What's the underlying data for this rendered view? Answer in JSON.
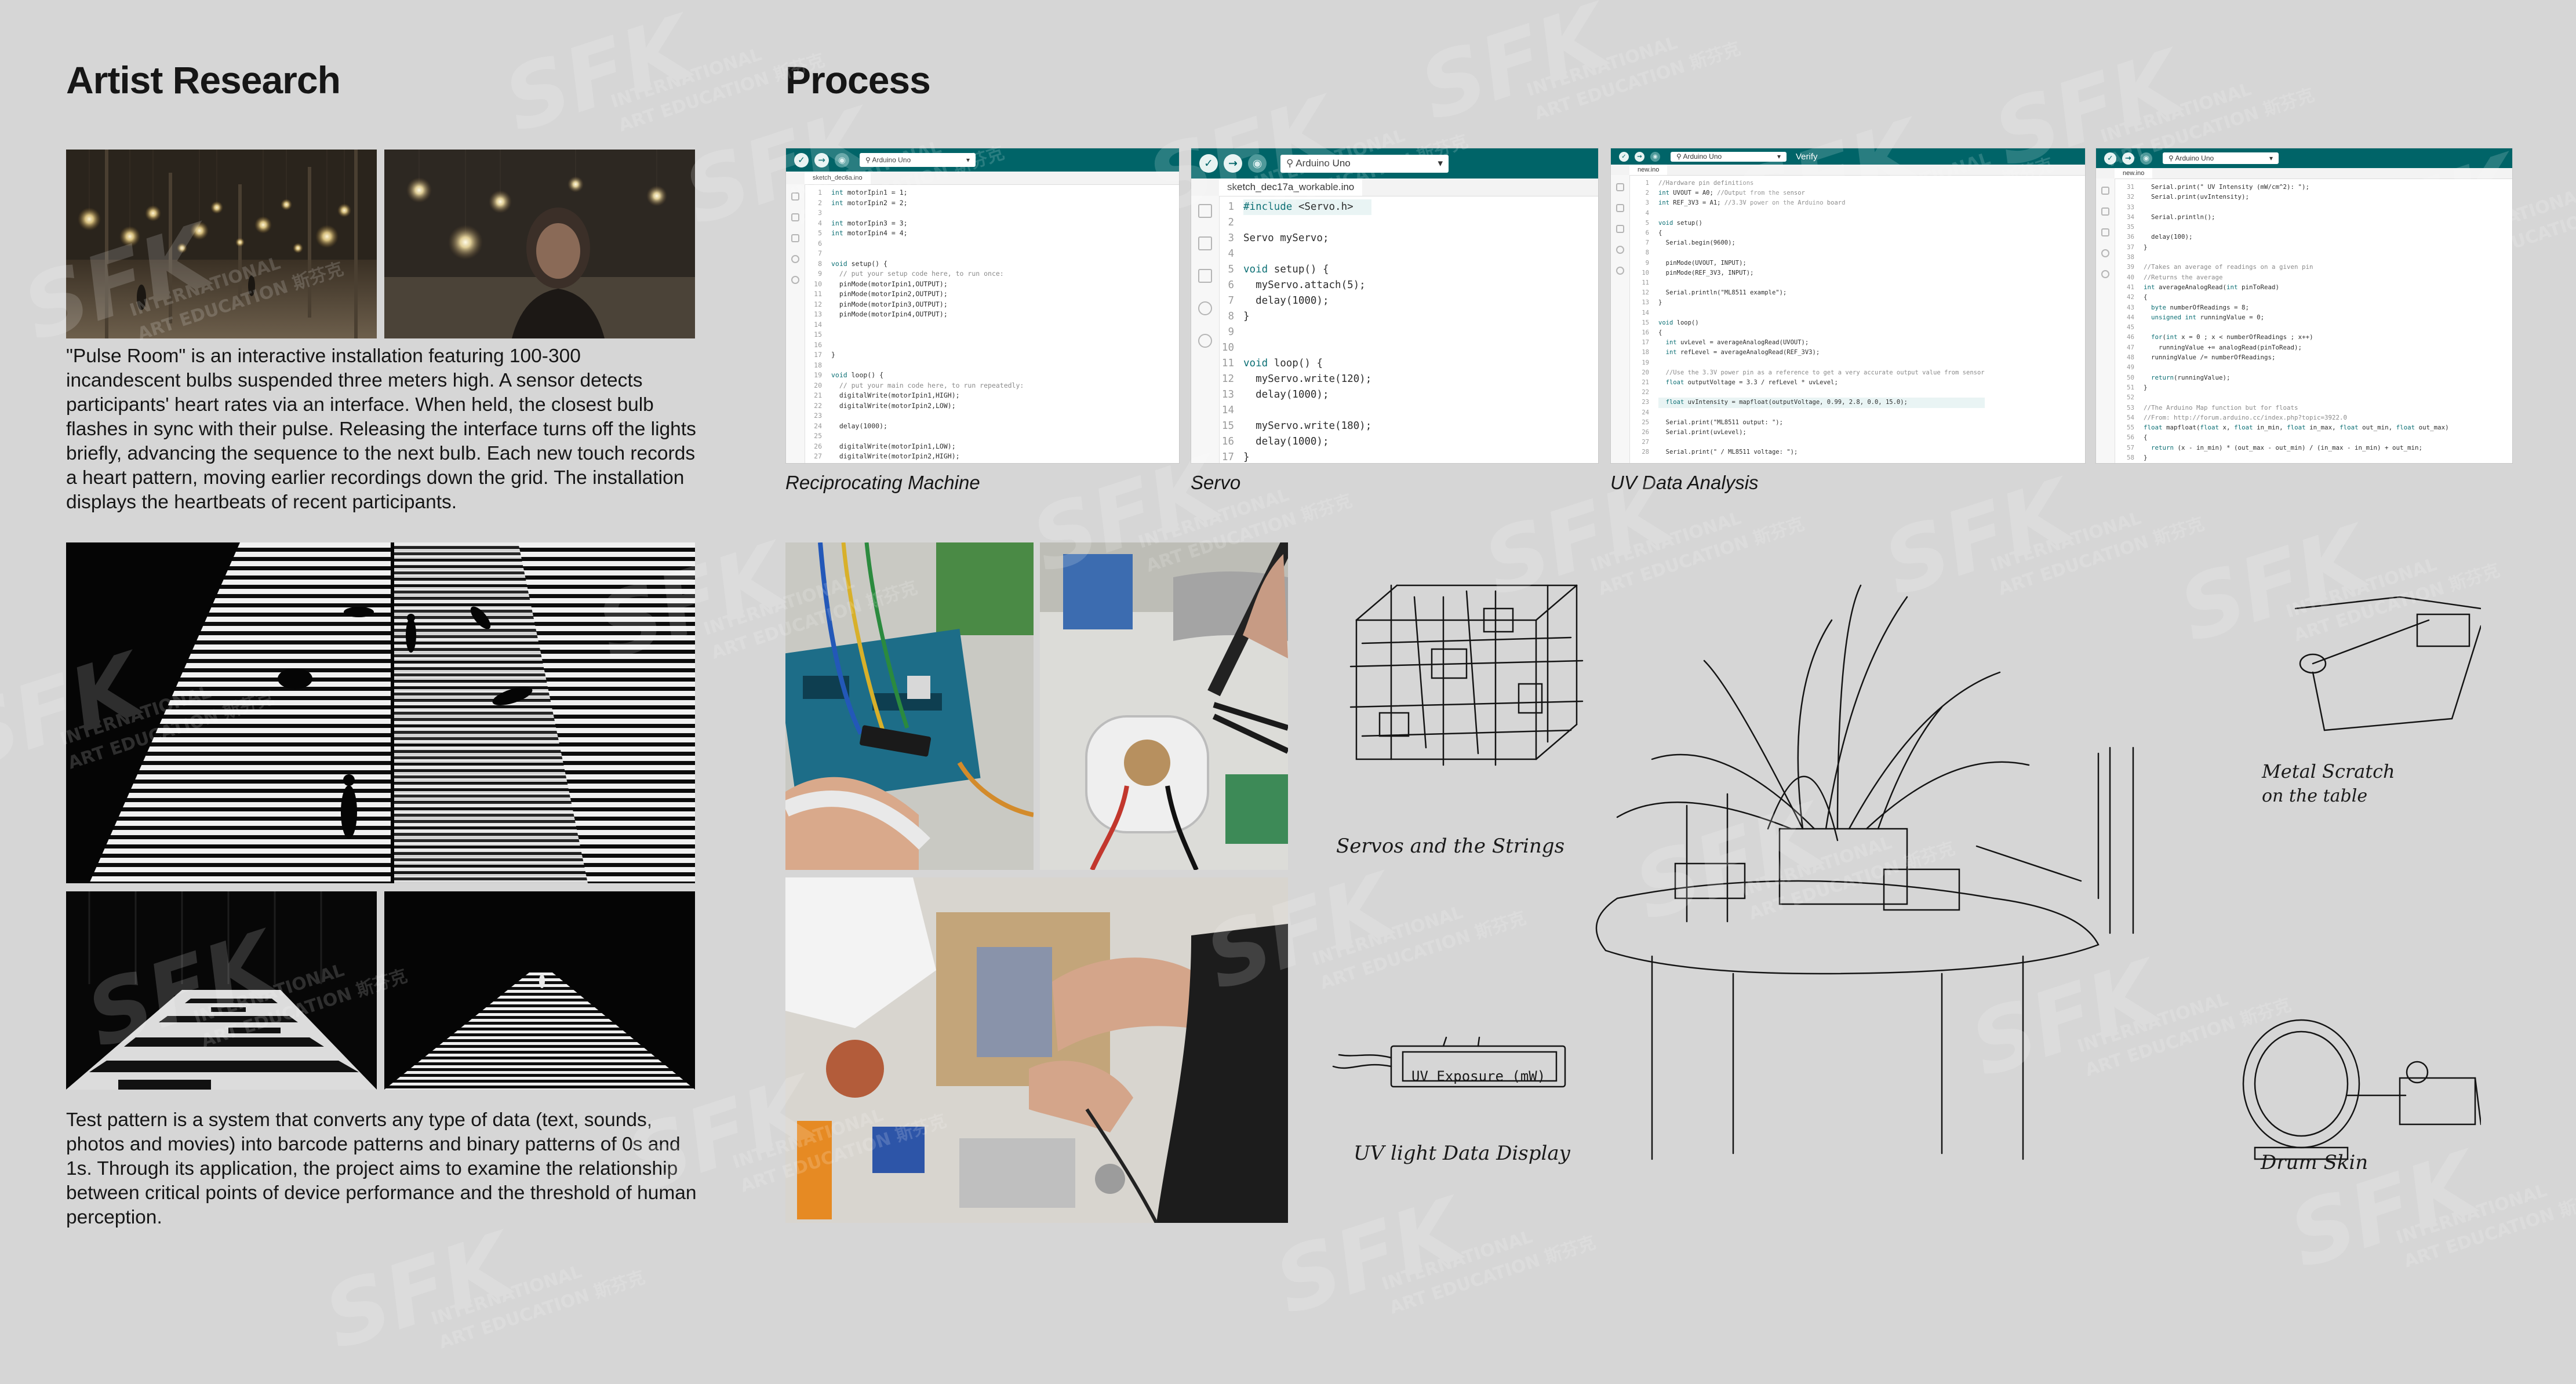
{
  "left_section": {
    "heading": "Artist Research",
    "pulse_room_text": "\"Pulse Room\" is an interactive installation featuring 100-300 incandescent bulbs suspended three meters high. A sensor detects participants' heart rates via an interface. When held, the closest bulb flashes in sync with their pulse. Releasing the interface turns off the lights briefly, advancing the sequence to the next bulb. Each new touch records a heart pattern, moving earlier recordings down the grid. The installation displays the heartbeats of recent participants.",
    "test_pattern_text": "Test pattern is a system that converts any type of data (text, sounds, photos and movies) into barcode patterns and binary patterns of 0s and 1s. Through its application, the project aims to examine the relationship between critical points of device performance and the threshold of human perception."
  },
  "right_section": {
    "heading": "Process",
    "captions": [
      "Reciprocating Machine",
      "Servo",
      "UV Data Analysis"
    ]
  },
  "ide_windows": [
    {
      "board": "Arduino Uno",
      "tab": "sketch_dec6a.ino",
      "lines": [
        "int motorIpin1 = 1;",
        "int motorIpin2 = 2;",
        "",
        "int motorIpin3 = 3;",
        "int motorIpin4 = 4;",
        "",
        "",
        "void setup() {",
        "  // put your setup code here, to run once:",
        "  pinMode(motorIpin1,OUTPUT);",
        "  pinMode(motorIpin2,OUTPUT);",
        "  pinMode(motorIpin3,OUTPUT);",
        "  pinMode(motorIpin4,OUTPUT);",
        "",
        "",
        "",
        "}",
        "",
        "void loop() {",
        "  // put your main code here, to run repeatedly:",
        "  digitalWrite(motorIpin1,HIGH);",
        "  digitalWrite(motorIpin2,LOW);",
        "",
        "  delay(1000);",
        "",
        "  digitalWrite(motorIpin1,LOW);",
        "  digitalWrite(motorIpin2,HIGH);"
      ]
    },
    {
      "board": "Arduino Uno",
      "tab": "sketch_dec17a_workable.ino",
      "lines": [
        "#include <Servo.h>",
        "",
        "Servo myServo;",
        "",
        "void setup() {",
        "  myServo.attach(5);",
        "  delay(1000);",
        "}",
        "",
        "",
        "void loop() {",
        "  myServo.write(120);",
        "  delay(1000);",
        "",
        "  myServo.write(180);",
        "  delay(1000);",
        "}"
      ]
    },
    {
      "board": "Arduino Uno",
      "verify": "Verify",
      "tab": "new.ino",
      "lines": [
        "//Hardware pin definitions",
        "int UVOUT = A0; //Output from the sensor",
        "int REF_3V3 = A1; //3.3V power on the Arduino board",
        "",
        "void setup()",
        "{",
        "  Serial.begin(9600);",
        "",
        "  pinMode(UVOUT, INPUT);",
        "  pinMode(REF_3V3, INPUT);",
        "",
        "  Serial.println(\"ML8511 example\");",
        "}",
        "",
        "void loop()",
        "{",
        "  int uvLevel = averageAnalogRead(UVOUT);",
        "  int refLevel = averageAnalogRead(REF_3V3);",
        "",
        "  //Use the 3.3V power pin as a reference to get a very accurate output value from sensor",
        "  float outputVoltage = 3.3 / refLevel * uvLevel;",
        "",
        "  float uvIntensity = mapfloat(outputVoltage, 0.99, 2.8, 0.0, 15.0);",
        "",
        "  Serial.print(\"ML8511 output: \");",
        "  Serial.print(uvLevel);",
        "",
        "  Serial.print(\" / ML8511 voltage: \");"
      ]
    },
    {
      "board": "Arduino Uno",
      "tab": "new.ino",
      "start": 31,
      "lines": [
        "  Serial.print(\" UV Intensity (mW/cm^2): \");",
        "  Serial.print(uvIntensity);",
        "",
        "  Serial.println();",
        "",
        "  delay(100);",
        "}",
        "",
        "//Takes an average of readings on a given pin",
        "//Returns the average",
        "int averageAnalogRead(int pinToRead)",
        "{",
        "  byte numberOfReadings = 8;",
        "  unsigned int runningValue = 0;",
        "",
        "  for(int x = 0 ; x < numberOfReadings ; x++)",
        "    runningValue += analogRead(pinToRead);",
        "  runningValue /= numberOfReadings;",
        "",
        "  return(runningValue);",
        "}",
        "",
        "//The Arduino Map function but for floats",
        "//From: http://forum.arduino.cc/index.php?topic=3922.0",
        "float mapfloat(float x, float in_min, float in_max, float out_min, float out_max)",
        "{",
        "  return (x - in_min) * (out_max - out_min) / (in_max - in_min) + out_min;",
        "}"
      ]
    }
  ],
  "sketches": {
    "servos_label": "Servos  and  the  Strings",
    "uv_screen": "UV Exposure (mW)",
    "uv_label": "UV light  Data  Display",
    "metal_label_1": "Metal  Scratch",
    "metal_label_2": "on  the  table",
    "drum_label": "Drum Skin"
  },
  "watermark": {
    "logo": "SFK",
    "line1": "INTERNATIONAL",
    "line2": "ART EDUCATION",
    "chinese": "斯芬克"
  },
  "colors": {
    "background": "#d6d6d6",
    "ide_teal": "#006468",
    "text": "#161616"
  }
}
